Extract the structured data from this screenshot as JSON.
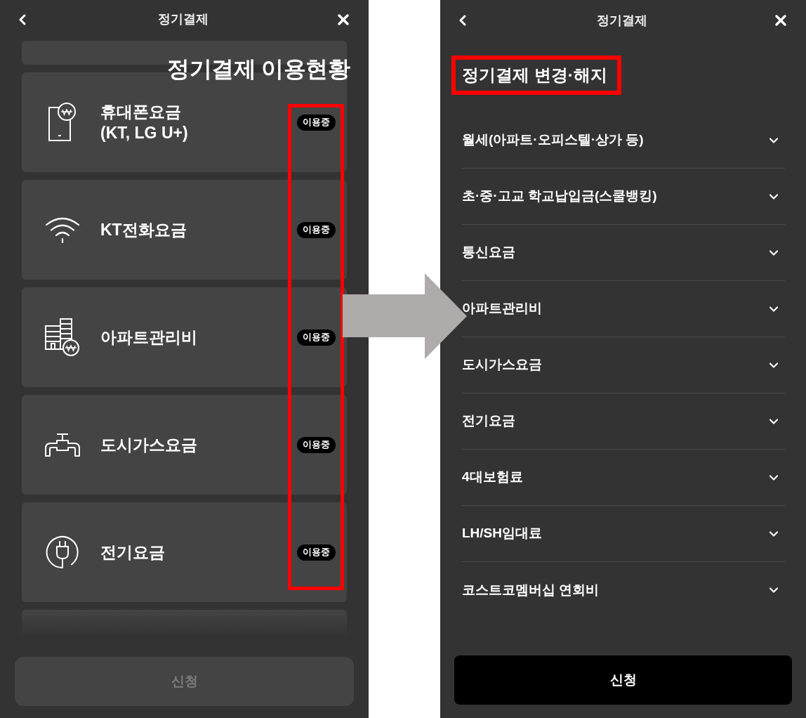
{
  "left_screen": {
    "title": "정기결제",
    "caption": "정기결제 이용현황",
    "services": [
      {
        "name": "휴대폰요금\n(KT, LG U+)",
        "badge": "이용중"
      },
      {
        "name": "KT전화요금",
        "badge": "이용중"
      },
      {
        "name": "아파트관리비",
        "badge": "이용중"
      },
      {
        "name": "도시가스요금",
        "badge": "이용중"
      },
      {
        "name": "전기요금",
        "badge": "이용중"
      }
    ],
    "apply_button": {
      "label": "신청",
      "disabled": true
    }
  },
  "right_screen": {
    "title": "정기결제",
    "section_title": "정기결제 변경·해지",
    "items": [
      {
        "label": "월세(아파트·오피스텔·상가 등)",
        "expanded": false
      },
      {
        "label": "초·중·고교 학교납입금(스쿨뱅킹)",
        "expanded": false
      },
      {
        "label": "통신요금",
        "expanded": false
      },
      {
        "label": "아파트관리비",
        "expanded": false
      },
      {
        "label": "도시가스요금",
        "expanded": false
      },
      {
        "label": "전기요금",
        "expanded": false
      },
      {
        "label": "4대보험료",
        "expanded": false
      },
      {
        "label": "LH/SH임대료",
        "expanded": false
      },
      {
        "label": "코스트코멤버십 연회비",
        "expanded": false
      }
    ],
    "apply_button": {
      "label": "신청",
      "disabled": false
    }
  }
}
